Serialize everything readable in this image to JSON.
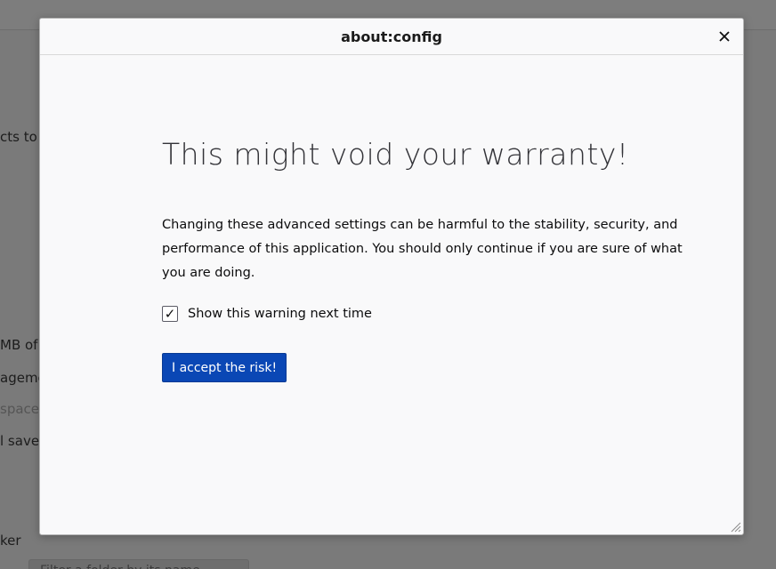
{
  "background": {
    "lines": [
      {
        "text": "cts to t",
        "dim": false
      },
      {
        "text": "MB of d",
        "dim": false
      },
      {
        "text": "agemen",
        "dim": false
      },
      {
        "text": "space",
        "dim": true
      },
      {
        "text": "l save",
        "dim": false
      },
      {
        "text": "ker",
        "dim": false
      }
    ],
    "filter_placeholder": "Filter a folder by its name..."
  },
  "dialog": {
    "title": "about:config",
    "close_icon": "close-icon",
    "warning_title": "This might void your warranty!",
    "warning_text": "Changing these advanced settings can be harmful to the stability, security, and performance of this application. You should only continue if you are sure of what you are doing.",
    "checkbox": {
      "label": "Show this warning next time",
      "checked": true,
      "check_glyph": "✓"
    },
    "accept_button": "I accept the risk!",
    "accent_color": "#0a47b5"
  }
}
